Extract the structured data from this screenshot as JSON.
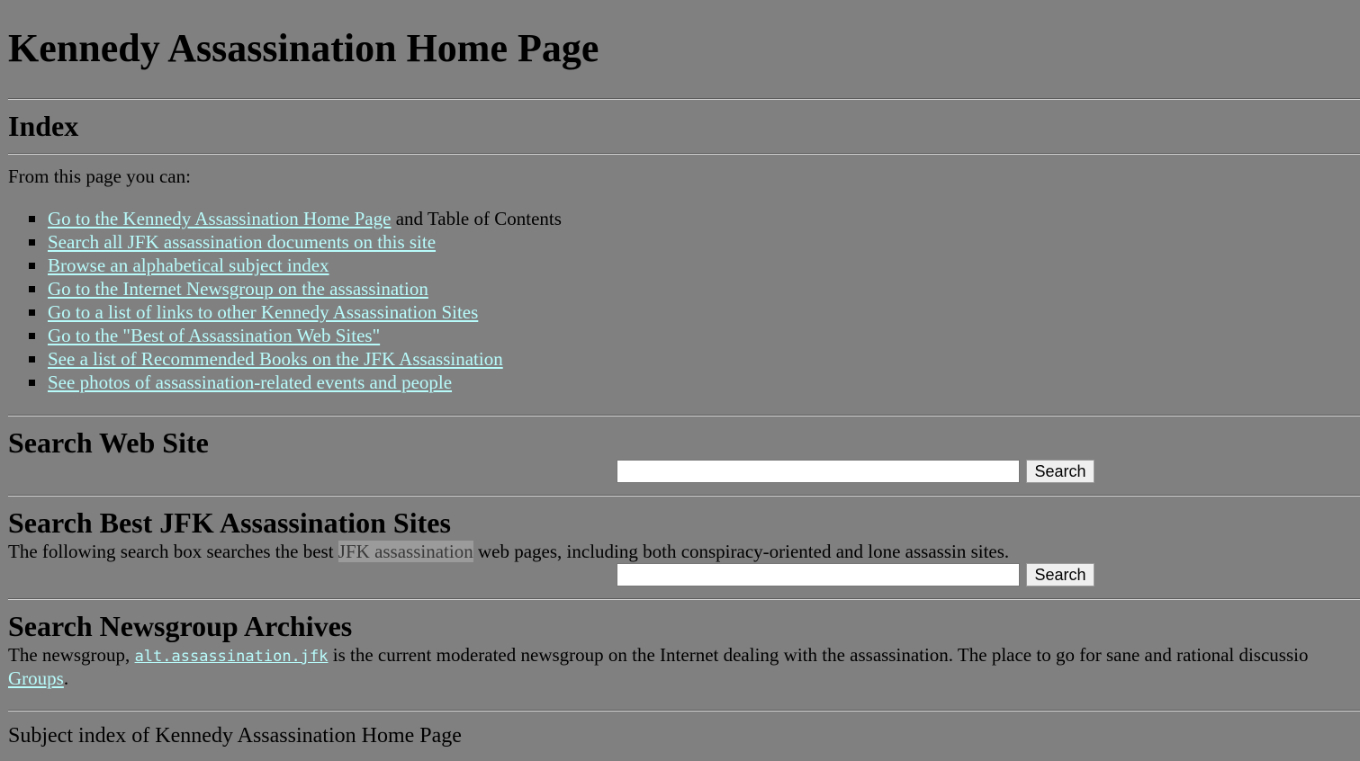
{
  "page": {
    "title": "Kennedy Assassination Home Page",
    "background": "#808080",
    "link_color": "#b8fbfb"
  },
  "index": {
    "heading": "Index",
    "intro": "From this page you can:",
    "items": [
      {
        "link": "Go to the Kennedy Assassination Home Page",
        "suffix": " and Table of Contents"
      },
      {
        "link": "Search all JFK assassination documents on this site",
        "suffix": ""
      },
      {
        "link": "Browse an alphabetical subject index",
        "suffix": ""
      },
      {
        "link": "Go to the Internet Newsgroup on the assassination",
        "suffix": ""
      },
      {
        "link": "Go to a list of links to other Kennedy Assassination Sites",
        "suffix": ""
      },
      {
        "link": "Go to the \"Best of Assassination Web Sites\"",
        "suffix": ""
      },
      {
        "link": "See a list of Recommended Books on the JFK Assassination",
        "suffix": ""
      },
      {
        "link": "See photos of assassination-related events and people",
        "suffix": ""
      }
    ]
  },
  "search_site": {
    "heading": "Search Web Site",
    "input_value": "",
    "button_label": "Search"
  },
  "search_best": {
    "heading": "Search Best JFK Assassination Sites",
    "desc_before": "The following search box searches the best ",
    "desc_highlight": "JFK assassination",
    "desc_after": " web pages, including both conspiracy-oriented and lone assassin sites.",
    "input_value": "",
    "button_label": "Search"
  },
  "newsgroup": {
    "heading": "Search Newsgroup Archives",
    "text_before": "The newsgroup, ",
    "newsgroup_link": "alt.assassination.jfk",
    "text_after": " is the current moderated newsgroup on the Internet dealing with the assassination. The place to go for sane and rational discussio",
    "groups_link": "Groups",
    "groups_suffix": "."
  },
  "footer": {
    "subject_index": "Subject index of Kennedy Assassination Home Page"
  }
}
